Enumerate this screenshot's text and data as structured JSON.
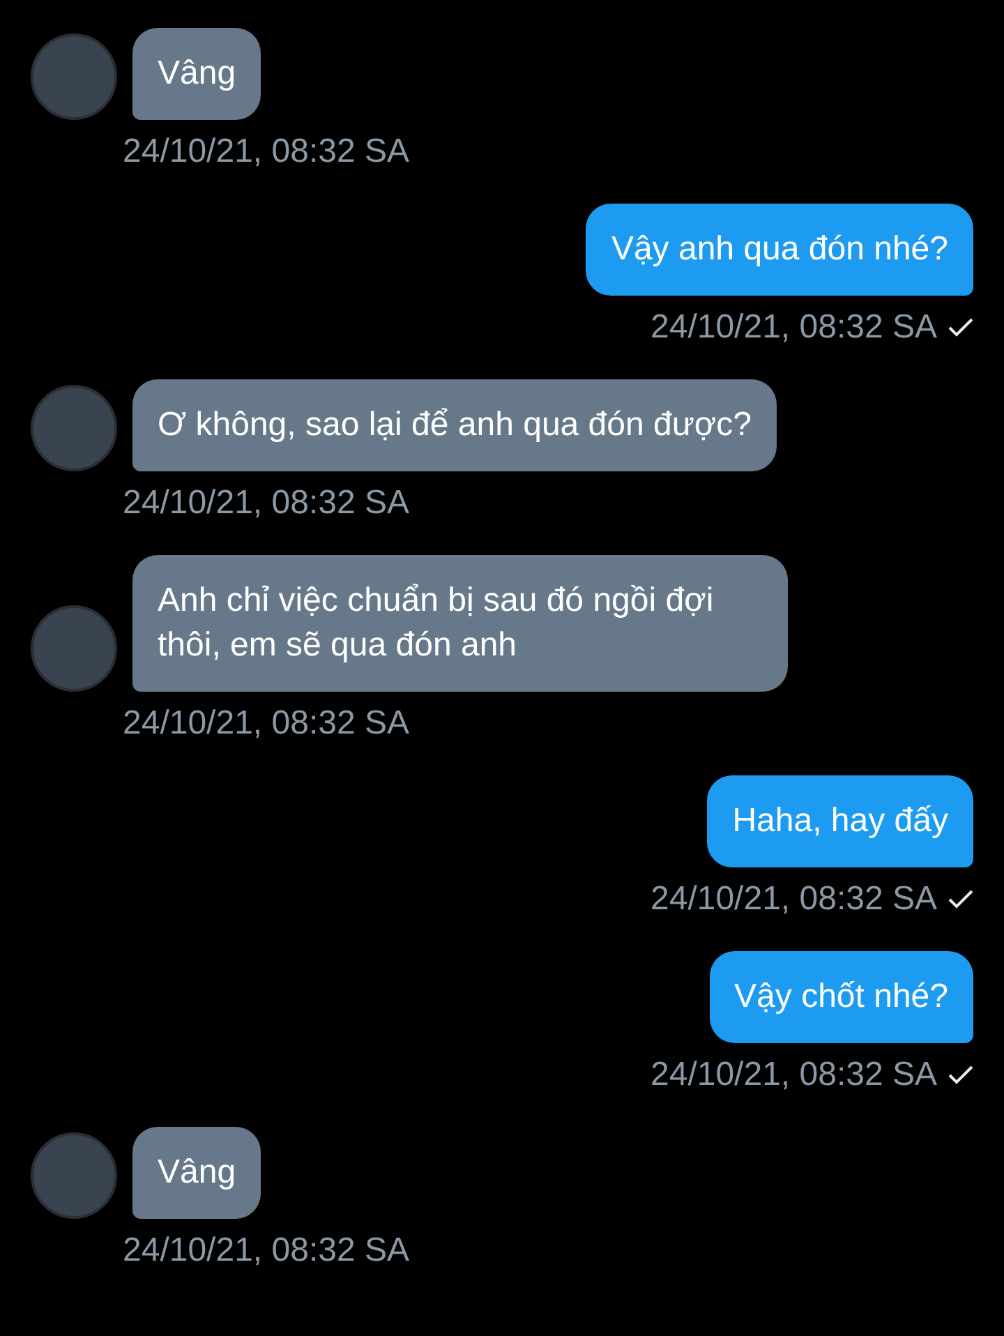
{
  "messages": [
    {
      "kind": "incoming",
      "text": "Vâng",
      "time": "24/10/21, 08:32 SA"
    },
    {
      "kind": "outgoing",
      "text": "Vậy anh qua đón nhé?",
      "time": "24/10/21, 08:32 SA",
      "seen": true
    },
    {
      "kind": "incoming",
      "text": "Ơ không, sao lại để anh qua đón được?",
      "time": "24/10/21, 08:32 SA"
    },
    {
      "kind": "incoming",
      "text": "Anh chỉ việc chuẩn bị sau đó ngồi đợi thôi, em sẽ qua đón anh",
      "time": "24/10/21, 08:32 SA"
    },
    {
      "kind": "outgoing",
      "text": "Haha, hay đấy",
      "time": "24/10/21, 08:32 SA",
      "seen": true
    },
    {
      "kind": "outgoing",
      "text": "Vậy chốt nhé?",
      "time": "24/10/21, 08:32 SA",
      "seen": true
    },
    {
      "kind": "incoming",
      "text": "Vâng",
      "time": "24/10/21, 08:32 SA"
    }
  ]
}
